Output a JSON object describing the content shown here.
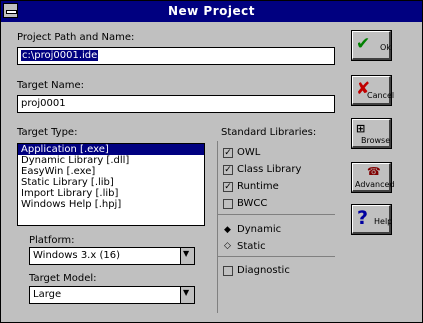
{
  "window": {
    "title": "New Project"
  },
  "project_path": {
    "label": "Project Path and Name:",
    "value": "c:\\proj0001.ide"
  },
  "target_name": {
    "label": "Target Name:",
    "value": "proj0001"
  },
  "target_type": {
    "label": "Target Type:",
    "items": [
      "Application [.exe]",
      "Dynamic Library [.dll]",
      "EasyWin [.exe]",
      "Static Library [.lib]",
      "Import Library [.lib]",
      "Windows Help [.hpj]"
    ],
    "selected_index": 0
  },
  "platform": {
    "label": "Platform:",
    "value": "Windows 3.x (16)"
  },
  "target_model": {
    "label": "Target Model:",
    "value": "Large"
  },
  "standard_libraries": {
    "label": "Standard Libraries:",
    "options": [
      {
        "label": "OWL",
        "checked": true
      },
      {
        "label": "Class Library",
        "checked": true
      },
      {
        "label": "Runtime",
        "checked": true
      },
      {
        "label": "BWCC",
        "checked": false
      }
    ],
    "linking": [
      {
        "label": "Dynamic",
        "selected": true
      },
      {
        "label": "Static",
        "selected": false
      }
    ],
    "diagnostic": {
      "label": "Diagnostic",
      "checked": false
    }
  },
  "buttons": {
    "ok": "Ok",
    "cancel": "Cancel",
    "browse": "Browse",
    "advanced": "Advanced",
    "help": "Help"
  },
  "colors": {
    "selection": "#000080",
    "ok_check": "#008000",
    "cancel_x": "#c00000",
    "help_q": "#0000a0"
  }
}
